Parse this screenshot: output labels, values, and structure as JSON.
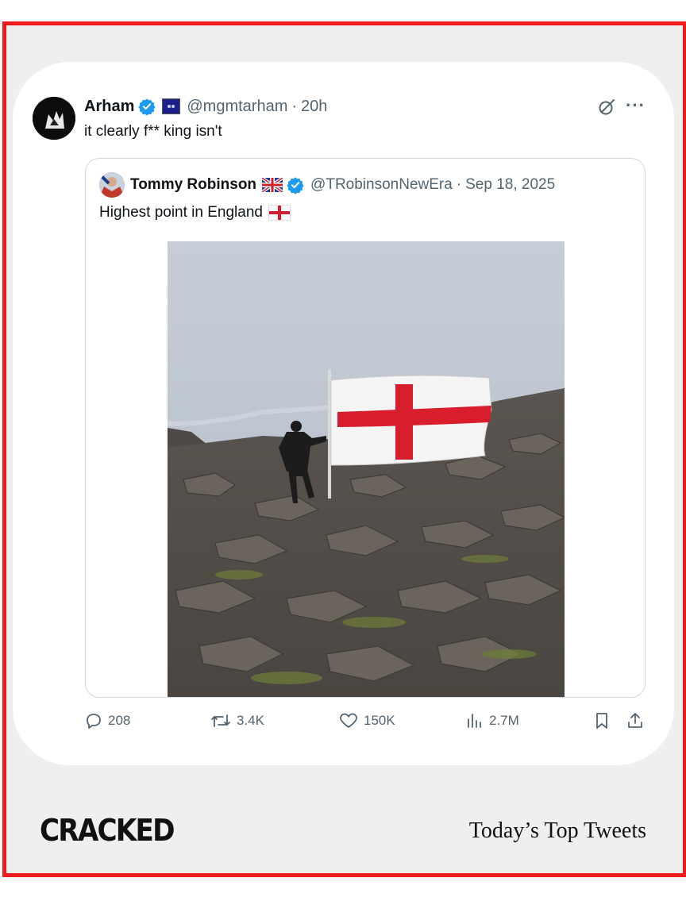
{
  "tweet": {
    "author_name": "Arham",
    "handle": "@mgmtarham",
    "separator": "·",
    "time": "20h",
    "text": "it clearly f** king isn't",
    "more_label": "···"
  },
  "quoted_tweet": {
    "author_name": "Tommy Robinson",
    "handle": "@TRobinsonNewEra",
    "separator": "·",
    "date": "Sep 18, 2025",
    "text": "Highest point in England"
  },
  "actions": {
    "replies": "208",
    "reposts": "3.4K",
    "likes": "150K",
    "views": "2.7M"
  },
  "footer": {
    "logo": "CRACKED",
    "tagline": "Today’s Top Tweets"
  },
  "colors": {
    "frame": "#ee1c1c",
    "background": "#f0efee",
    "verified": "#1d9bf0",
    "muted": "#536471"
  },
  "icons": [
    "verified-badge-icon",
    "grok-icon",
    "more-icon",
    "reply-icon",
    "repost-icon",
    "like-icon",
    "views-icon",
    "bookmark-icon",
    "share-icon"
  ]
}
